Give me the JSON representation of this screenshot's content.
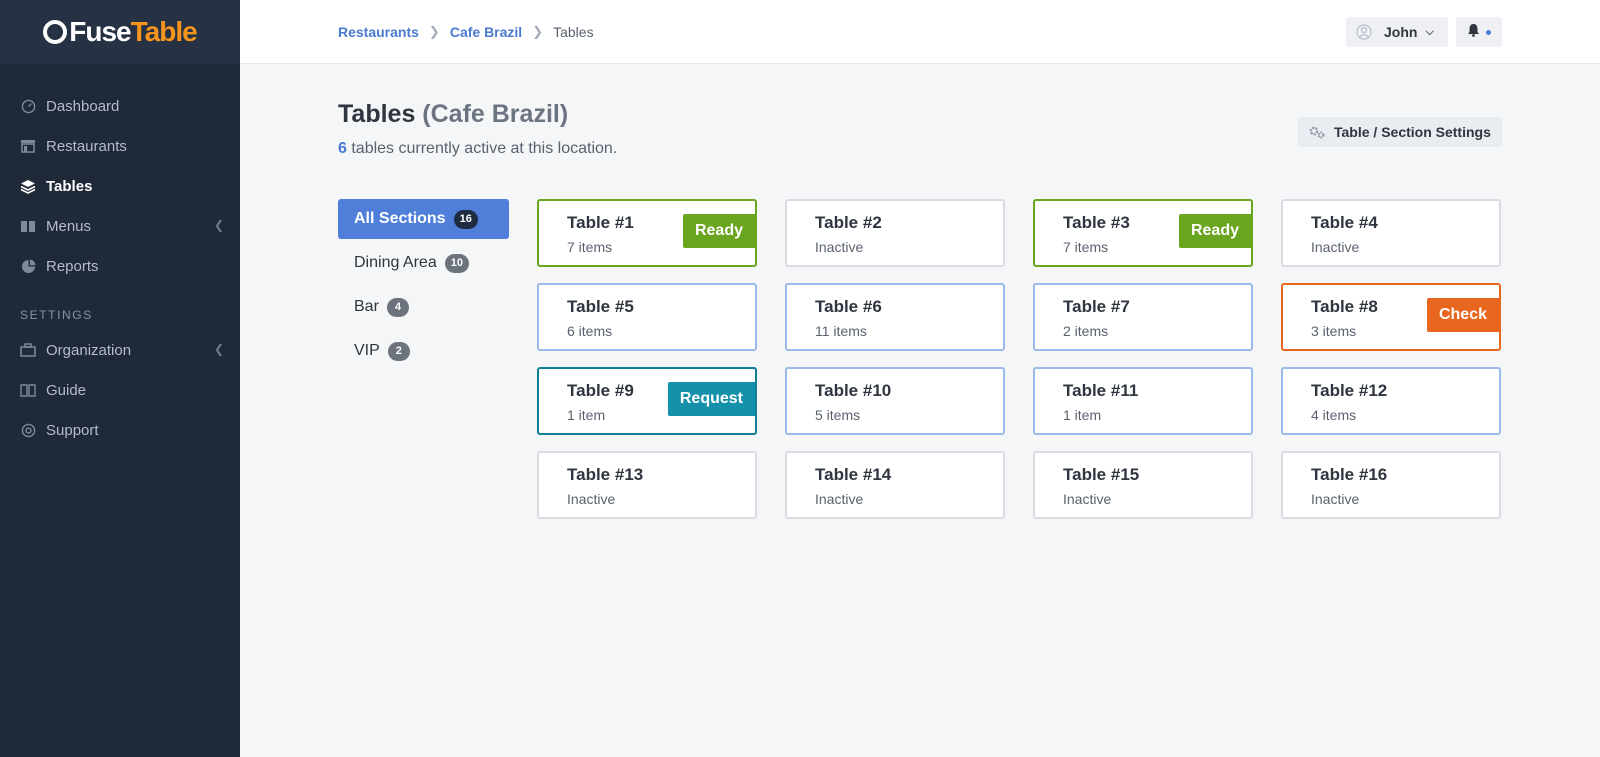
{
  "brand": {
    "part1": "Fuse",
    "part2": "Table"
  },
  "sidebar": {
    "items": [
      {
        "label": "Dashboard",
        "icon": "gauge-icon"
      },
      {
        "label": "Restaurants",
        "icon": "store-icon"
      },
      {
        "label": "Tables",
        "icon": "layers-icon",
        "active": true
      },
      {
        "label": "Menus",
        "icon": "book-icon",
        "has_caret": true
      },
      {
        "label": "Reports",
        "icon": "pie-chart-icon"
      }
    ],
    "settings_heading": "SETTINGS",
    "settings_items": [
      {
        "label": "Organization",
        "icon": "briefcase-icon",
        "has_caret": true
      },
      {
        "label": "Guide",
        "icon": "guide-book-icon"
      },
      {
        "label": "Support",
        "icon": "lifebuoy-icon"
      }
    ]
  },
  "breadcrumb": {
    "item1": "Restaurants",
    "item2": "Cafe Brazil",
    "current": "Tables"
  },
  "user": {
    "name": "John"
  },
  "page": {
    "title": "Tables",
    "title_sub": "(Cafe Brazil)",
    "active_count": "6",
    "subtitle_rest": " tables currently active at this location.",
    "settings_label": "Table / Section Settings"
  },
  "sections": [
    {
      "label": "All Sections",
      "count": "16",
      "active": true
    },
    {
      "label": "Dining Area",
      "count": "10"
    },
    {
      "label": "Bar",
      "count": "4"
    },
    {
      "label": "VIP",
      "count": "2"
    }
  ],
  "tables": [
    {
      "name": "Table #1",
      "sub": "7 items",
      "state": "ready",
      "status": "Ready"
    },
    {
      "name": "Table #2",
      "sub": "Inactive",
      "state": "inactive",
      "status": ""
    },
    {
      "name": "Table #3",
      "sub": "7 items",
      "state": "ready",
      "status": "Ready"
    },
    {
      "name": "Table #4",
      "sub": "Inactive",
      "state": "inactive",
      "status": ""
    },
    {
      "name": "Table #5",
      "sub": "6 items",
      "state": "active",
      "status": ""
    },
    {
      "name": "Table #6",
      "sub": "11 items",
      "state": "active",
      "status": ""
    },
    {
      "name": "Table #7",
      "sub": "2 items",
      "state": "active",
      "status": ""
    },
    {
      "name": "Table #8",
      "sub": "3 items",
      "state": "check",
      "status": "Check"
    },
    {
      "name": "Table #9",
      "sub": "1 item",
      "state": "request",
      "status": "Request"
    },
    {
      "name": "Table #10",
      "sub": "5 items",
      "state": "active",
      "status": ""
    },
    {
      "name": "Table #11",
      "sub": "1 item",
      "state": "active",
      "status": ""
    },
    {
      "name": "Table #12",
      "sub": "4 items",
      "state": "active",
      "status": ""
    },
    {
      "name": "Table #13",
      "sub": "Inactive",
      "state": "inactive",
      "status": ""
    },
    {
      "name": "Table #14",
      "sub": "Inactive",
      "state": "inactive",
      "status": ""
    },
    {
      "name": "Table #15",
      "sub": "Inactive",
      "state": "inactive",
      "status": ""
    },
    {
      "name": "Table #16",
      "sub": "Inactive",
      "state": "inactive",
      "status": ""
    }
  ],
  "colors": {
    "ready": "#6aa51f",
    "check": "#e8661e",
    "request": "#1691ab",
    "accent": "#4f7fd9",
    "sidebar": "#1f2937"
  }
}
